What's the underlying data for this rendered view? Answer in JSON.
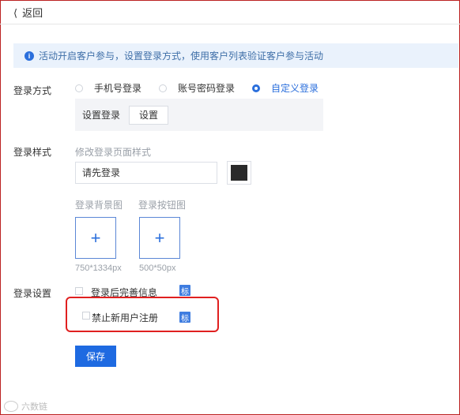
{
  "header": {
    "back_label": "返回",
    "back_icon": "chevron-left-icon"
  },
  "notice": {
    "text": "活动开启客户参与，设置登录方式，使用客户列表验证客户参与活动",
    "icon": "info-icon"
  },
  "login_method": {
    "label": "登录方式",
    "options": [
      "手机号登录",
      "账号密码登录",
      "自定义登录"
    ],
    "selected_index": 2,
    "settings_label": "设置登录",
    "settings_button": "设置"
  },
  "login_style": {
    "label": "登录样式",
    "hint": "修改登录页面样式",
    "input_value": "请先登录",
    "color_swatch": "#2a2a2a",
    "upload_bg": {
      "label": "登录背景图",
      "size": "750*1334px"
    },
    "upload_btn": {
      "label": "登录按钮图",
      "size": "500*50px"
    }
  },
  "login_settings": {
    "label": "登录设置",
    "options": [
      {
        "label": "登录后完善信息",
        "tag": "标",
        "checked": false
      },
      {
        "label": "禁止新用户注册",
        "tag": "标",
        "checked": false
      }
    ]
  },
  "save_button": "保存",
  "watermark": "六数链"
}
